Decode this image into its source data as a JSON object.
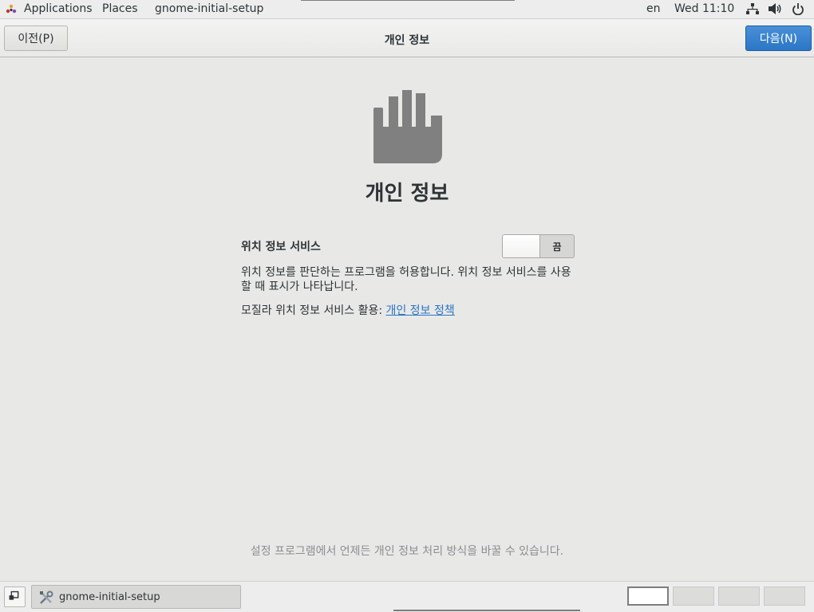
{
  "topbar": {
    "applications": "Applications",
    "places": "Places",
    "app_name": "gnome-initial-setup",
    "language": "en",
    "clock": "Wed 11:10",
    "icons": [
      "network-icon",
      "volume-icon",
      "power-icon"
    ]
  },
  "header": {
    "prev_label": "이전(P)",
    "title": "개인 정보",
    "next_label": "다음(N)"
  },
  "main": {
    "icon": "hand-icon",
    "heading": "개인 정보",
    "location": {
      "label": "위치 정보 서비스",
      "toggle_state": "끔",
      "description": "위치 정보를 판단하는 프로그램을 허용합니다. 위치 정보 서비스를 사용할 때 표시가 나타납니다.",
      "mozilla_prefix": "모질라 위치 정보 서비스 활용: ",
      "policy_link": "개인 정보 정책"
    },
    "footer_note": "설정 프로그램에서 언제든 개인 정보 처리 방식을 바꿀 수 있습니다."
  },
  "taskbar": {
    "task_label": "gnome-initial-setup",
    "workspaces": 4
  },
  "colors": {
    "accent": "#2a76c6",
    "background": "#e8e8e7",
    "icon_gray": "#808080"
  }
}
